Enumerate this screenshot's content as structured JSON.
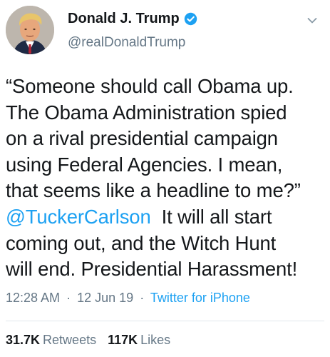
{
  "header": {
    "display_name": "Donald J. Trump",
    "handle": "@realDonaldTrump",
    "verified_color": "#1da1f2"
  },
  "icons": {
    "avatar": "profile-photo",
    "verified": "verified-badge-icon",
    "menu": "chevron-down-icon"
  },
  "tweet": {
    "lines": [
      "“Someone should call Obama up.",
      "The Obama Administration spied",
      "on a rival presidential campaign",
      "using Federal Agencies. I mean,",
      "that seems like a headline to me?”",
      "coming out, and the Witch Hunt",
      "will end. Presidential Harassment!"
    ],
    "mention": "@TuckerCarlson",
    "after_mention": "  It will all start"
  },
  "meta": {
    "time": "12:28 AM",
    "date": "12 Jun 19",
    "separator": "·",
    "source": "Twitter for iPhone"
  },
  "stats": {
    "retweets_count": "31.7K",
    "retweets_label": "Retweets",
    "likes_count": "117K",
    "likes_label": "Likes"
  },
  "colors": {
    "link": "#1da1f2",
    "secondary_text": "#657786",
    "primary_text": "#14171a",
    "divider": "#e1e8ed"
  }
}
